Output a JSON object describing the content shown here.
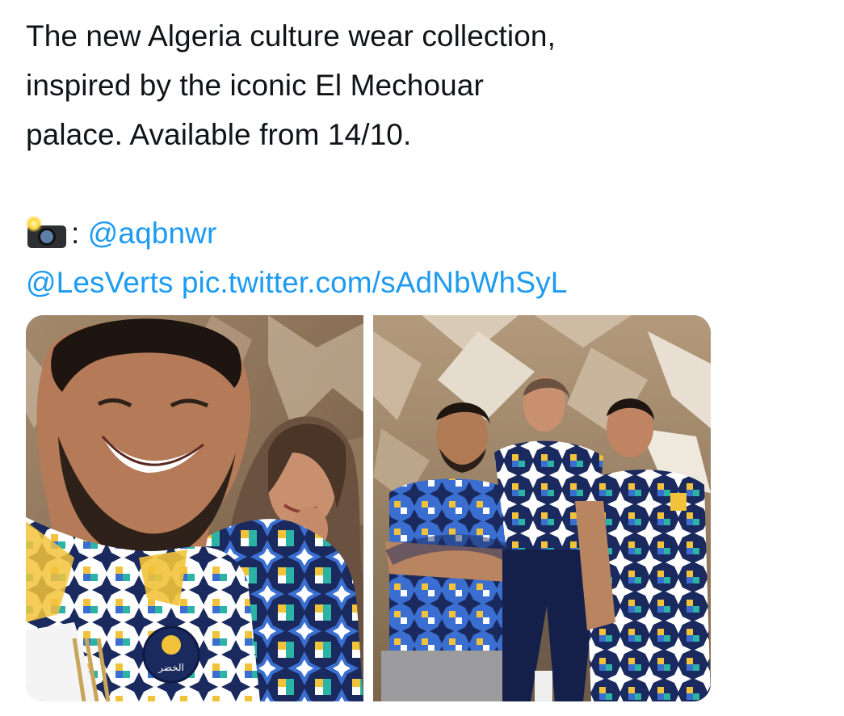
{
  "tweet": {
    "lines": [
      "The new Algeria culture wear collection,",
      "inspired by the iconic El Mechouar",
      "palace. Available from 14/10."
    ],
    "camera_icon": "camera-with-flash-icon",
    "photo_credit_sep": ": ",
    "photo_credit_handle": "@aqbnwr",
    "mention": "@LesVerts",
    "pic_link": "pic.twitter.com/sAdNbWhSyL"
  },
  "media": {
    "images": [
      {
        "name": "photo-left",
        "description_icon": "photo"
      },
      {
        "name": "photo-right",
        "description_icon": "photo"
      }
    ],
    "badge_text": "الخضر"
  },
  "colors": {
    "link": "#1d9bf0",
    "text": "#0f1419",
    "jersey_navy": "#1b2a5e",
    "jersey_teal": "#2bb3a6",
    "jersey_yellow": "#f2c33a",
    "jersey_blue": "#3a6fd1"
  }
}
